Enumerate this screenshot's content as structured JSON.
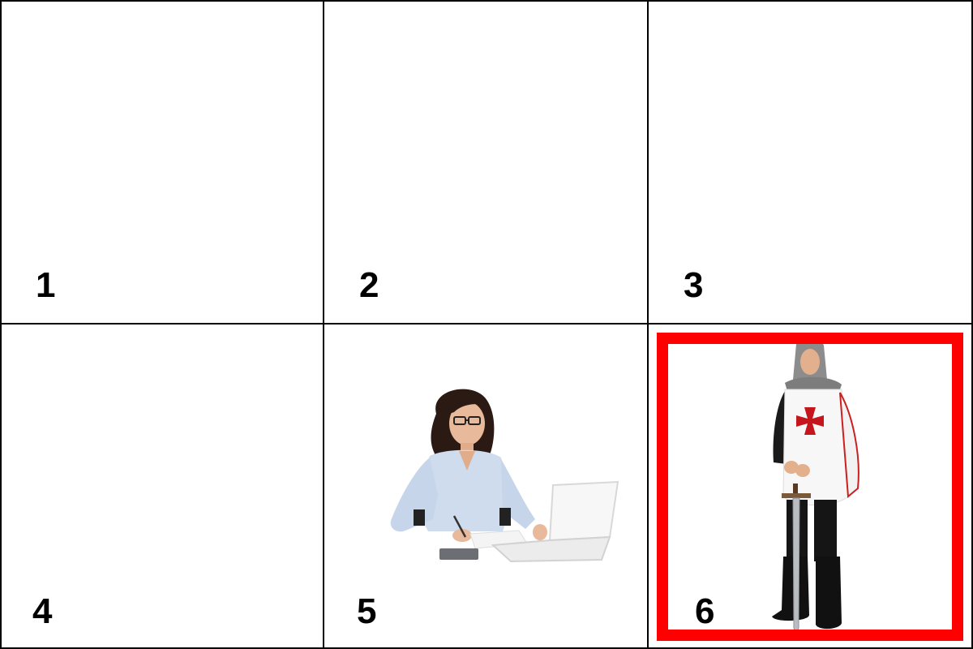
{
  "cells": [
    {
      "id": 1,
      "label": "1",
      "content": "empty"
    },
    {
      "id": 2,
      "label": "2",
      "content": "empty"
    },
    {
      "id": 3,
      "label": "3",
      "content": "empty"
    },
    {
      "id": 4,
      "label": "4",
      "content": "empty"
    },
    {
      "id": 5,
      "label": "5",
      "content": "woman-at-laptop-image"
    },
    {
      "id": 6,
      "label": "6",
      "content": "crusader-knight-image",
      "selected": true
    }
  ],
  "colors": {
    "grid_line": "#000000",
    "selection_border": "#ff0000",
    "background": "#ffffff"
  }
}
